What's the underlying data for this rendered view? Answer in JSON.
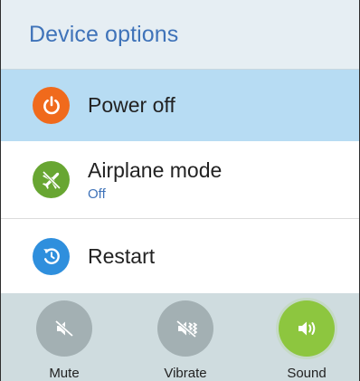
{
  "dialog": {
    "title": "Device options"
  },
  "items": [
    {
      "label": "Power off",
      "icon": "power-icon",
      "color": "#f06a1c",
      "highlighted": true
    },
    {
      "label": "Airplane mode",
      "sublabel": "Off",
      "icon": "airplane-icon",
      "color": "#68a632"
    },
    {
      "label": "Restart",
      "icon": "restart-icon",
      "color": "#2f8fdd"
    }
  ],
  "sound_modes": [
    {
      "label": "Mute",
      "icon": "mute-icon",
      "active": false
    },
    {
      "label": "Vibrate",
      "icon": "vibrate-icon",
      "active": false
    },
    {
      "label": "Sound",
      "icon": "sound-icon",
      "active": true
    }
  ],
  "colors": {
    "accent": "#3f73b9",
    "highlight": "#b7dcf3",
    "mode_inactive": "#a3b0b3",
    "mode_active": "#8dc63f"
  }
}
